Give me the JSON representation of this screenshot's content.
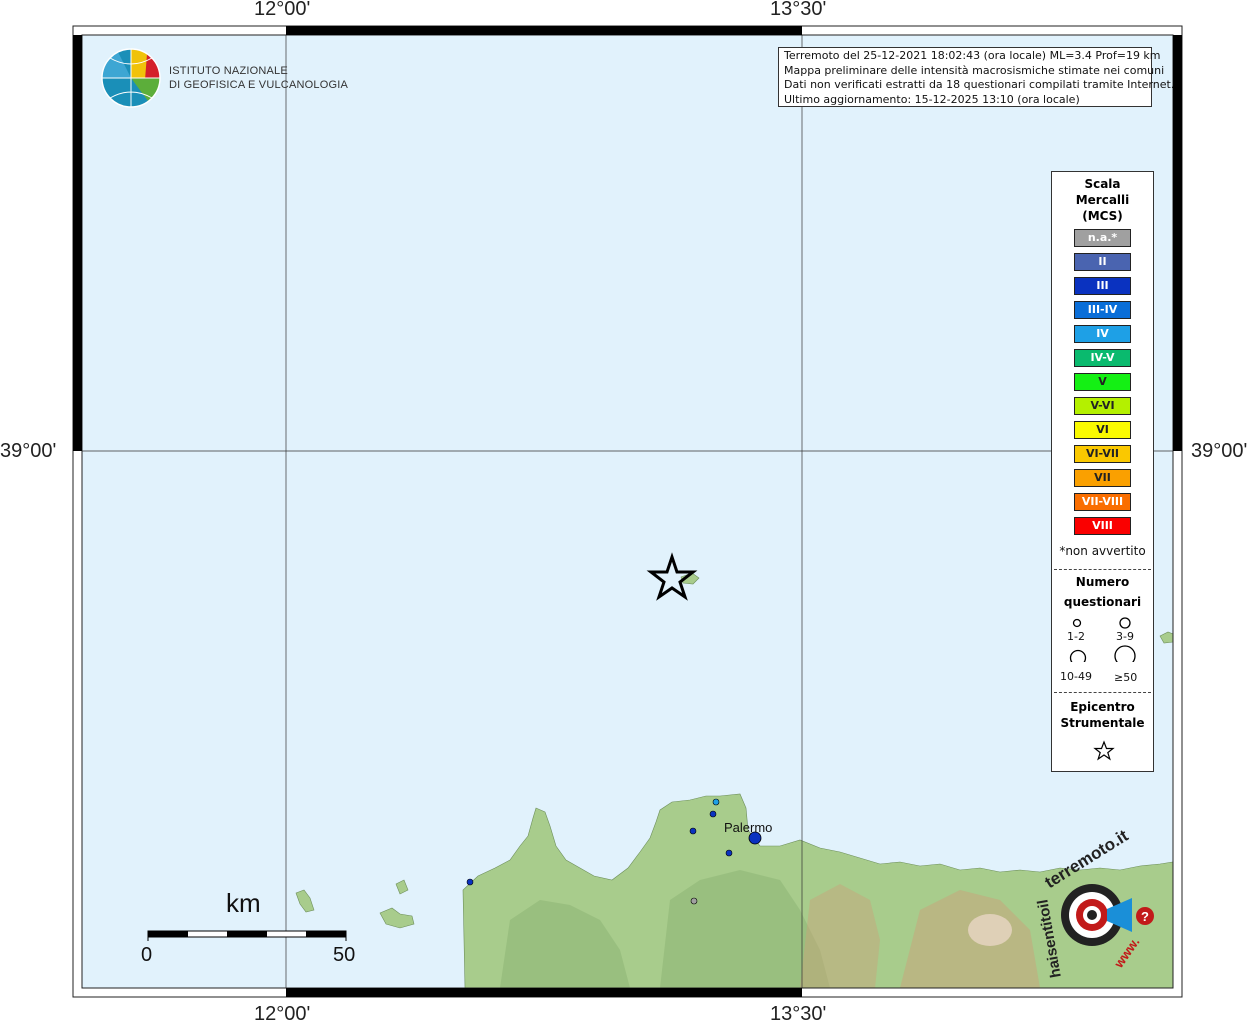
{
  "coords": {
    "lon_left": "12°00'",
    "lon_right": "13°30'",
    "lat_mid": "39°00'"
  },
  "institute": {
    "line1": "ISTITUTO NAZIONALE",
    "line2": "DI GEOFISICA E VULCANOLOGIA"
  },
  "info_box": {
    "line1": "Terremoto del 25-12-2021 18:02:43 (ora locale) ML=3.4 Prof=19 km",
    "line2": "Mappa preliminare delle intensità macrosismiche stimate nei comuni",
    "line3": "Dati non verificati estratti da 18 questionari compilati tramite Internet.",
    "line4": "Ultimo aggiornamento: 15-12-2025 13:10 (ora locale)"
  },
  "legend": {
    "title": "Scala Mercalli (MCS)",
    "classes": [
      {
        "label": "n.a.*",
        "color": "#a0a0a0"
      },
      {
        "label": "II",
        "color": "#4a64b0"
      },
      {
        "label": "III",
        "color": "#0a32c0"
      },
      {
        "label": "III-IV",
        "color": "#0a6ed8"
      },
      {
        "label": "IV",
        "color": "#1ea0e6"
      },
      {
        "label": "IV-V",
        "color": "#0aba6e"
      },
      {
        "label": "V",
        "color": "#14f014"
      },
      {
        "label": "V-VI",
        "color": "#b4f000"
      },
      {
        "label": "VI",
        "color": "#fafa00"
      },
      {
        "label": "VI-VII",
        "color": "#fac800"
      },
      {
        "label": "VII",
        "color": "#faa000"
      },
      {
        "label": "VII-VIII",
        "color": "#fa6e00"
      },
      {
        "label": "VIII",
        "color": "#fa0000"
      }
    ],
    "note": "*non avvertito",
    "count_title_1": "Numero",
    "count_title_2": "questionari",
    "sizes": [
      "1-2",
      "3-9",
      "10-49",
      "≥50"
    ],
    "epicenter_title_1": "Epicentro",
    "epicenter_title_2": "Strumentale"
  },
  "scale": {
    "unit": "km",
    "min": "0",
    "max": "50"
  },
  "places": {
    "city": "Palermo"
  },
  "brand": {
    "top": "terremoto.it",
    "side": "haisentitoil",
    "bottom": "www."
  },
  "colors": {
    "sea": "#e1f2fc",
    "land": "#a8cc8c",
    "land_dark": "#8fb577",
    "mountain": "#c9a27a"
  },
  "observations": [
    {
      "intensity": "III",
      "count_class": "1-2"
    },
    {
      "intensity": "III",
      "count_class": "1-2"
    },
    {
      "intensity": "III",
      "count_class": "1-2"
    },
    {
      "intensity": "III",
      "count_class": "1-2"
    },
    {
      "intensity": "IV",
      "count_class": "1-2"
    },
    {
      "intensity": "III",
      "count_class": "3-9"
    },
    {
      "intensity": "n.a.*",
      "count_class": "1-2"
    }
  ]
}
